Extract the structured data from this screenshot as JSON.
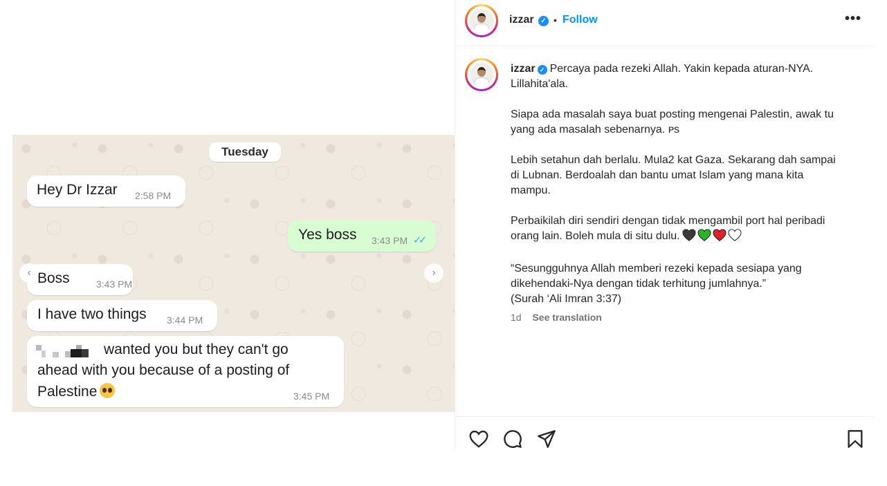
{
  "post": {
    "username": "izzar",
    "follow_label": "Follow",
    "separator": "•",
    "more_label": "•••",
    "verified_mark": "✓",
    "caption": {
      "username": "izzar",
      "paragraphs": [
        "Percaya pada rezeki Allah. Yakin kepada aturan-NYA. Lillahita'ala.",
        "Siapa ada masalah saya buat posting mengenai Palestin, awak tu\nyang ada masalah sebenarnya. ᴘs",
        "Lebih setahun dah berlalu. Mula2 kat Gaza. Sekarang dah sampai\ndi Lubnan. Berdoalah dan bantu umat Islam yang mana kita\nmampu.",
        "Perbaikilah diri sendiri dengan tidak mengambil port hal peribadi\norang lain. Boleh mula di situ dulu.",
        "“Sesungguhnya Allah memberi rezeki kepada sesiapa yang\ndikehendaki-Nya dengan tidak terhitung jumlahnya.”\n(Surah ‘Ali Imran 3:37)"
      ],
      "hearts": [
        "#3a3a3a",
        "#2bb32b",
        "#e0202a",
        "#ffffff"
      ]
    },
    "age": "1d",
    "translate_label": "See translation"
  },
  "chat": {
    "day_label": "Tuesday",
    "messages": [
      {
        "text": "Hey Dr Izzar",
        "time": "2:58 PM",
        "side": "in"
      },
      {
        "text": "Yes boss",
        "time": "3:43 PM",
        "side": "out",
        "ticks": "✓✓"
      },
      {
        "text": "Boss",
        "time": "3:43 PM",
        "side": "in"
      },
      {
        "text": "I have two things",
        "time": "3:44 PM",
        "side": "in"
      },
      {
        "lines": [
          "wanted you but they can't go",
          "ahead with you because of a posting of",
          "Palestine"
        ],
        "time": "3:45 PM",
        "side": "in"
      }
    ],
    "prev_arrow": "‹",
    "next_arrow": "›"
  },
  "colors": {
    "accent": "#0095f6",
    "outgoing_bubble": "#d9fdd3",
    "chat_background": "#efe9e0"
  },
  "icons": [
    "heart-icon",
    "comment-icon",
    "share-icon",
    "bookmark-icon",
    "verified-badge-icon",
    "more-icon"
  ]
}
